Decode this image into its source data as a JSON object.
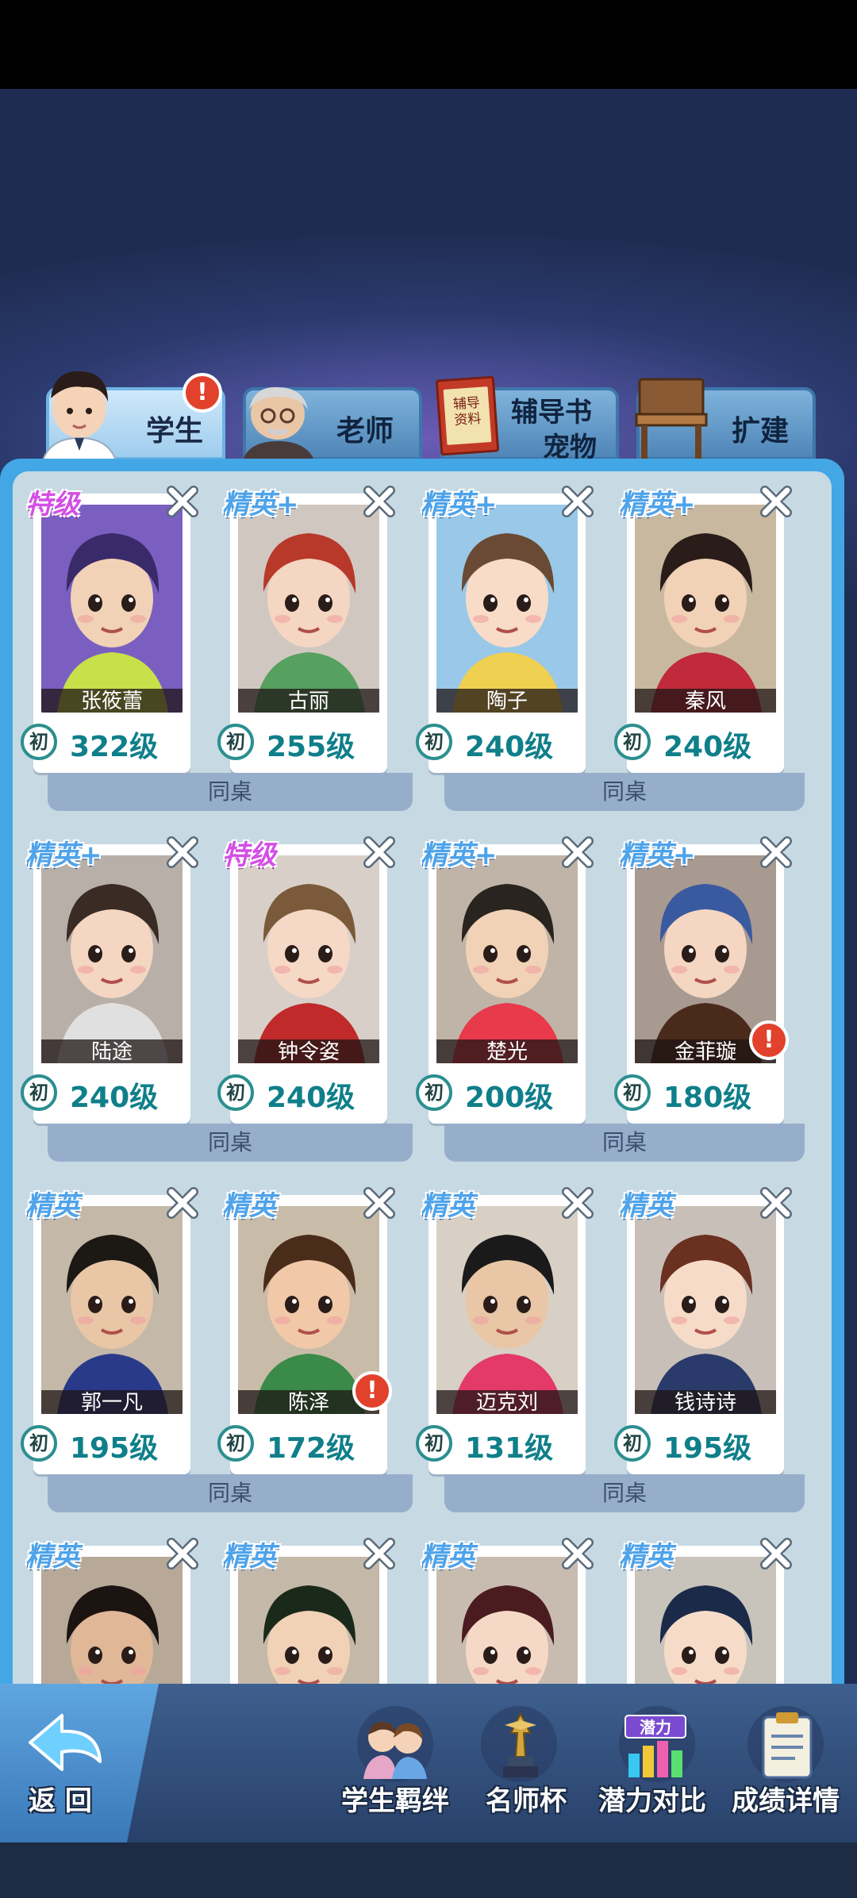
{
  "tabs": [
    {
      "label": "学生",
      "active": true
    },
    {
      "label": "老师",
      "active": false
    },
    {
      "label": "辅导书\n宠物",
      "line1": "辅导书",
      "line2": "宠物",
      "active": false
    },
    {
      "label": "扩建",
      "active": false
    }
  ],
  "tab_book_text": "辅导\n资料",
  "tab_book_line1": "辅导",
  "tab_book_line2": "资料",
  "students": [
    {
      "name": "张筱蕾",
      "level": "322级",
      "rank": "特级",
      "grade": "初",
      "badge": false
    },
    {
      "name": "古丽",
      "level": "255级",
      "rank": "精英+",
      "grade": "初",
      "badge": false
    },
    {
      "name": "陶子",
      "level": "240级",
      "rank": "精英+",
      "grade": "初",
      "badge": false
    },
    {
      "name": "秦风",
      "level": "240级",
      "rank": "精英+",
      "grade": "初",
      "badge": false
    },
    {
      "name": "陆途",
      "level": "240级",
      "rank": "精英+",
      "grade": "初",
      "badge": false
    },
    {
      "name": "钟令姿",
      "level": "240级",
      "rank": "特级",
      "grade": "初",
      "badge": false
    },
    {
      "name": "楚光",
      "level": "200级",
      "rank": "精英+",
      "grade": "初",
      "badge": false
    },
    {
      "name": "金菲璇",
      "level": "180级",
      "rank": "精英+",
      "grade": "初",
      "badge": true
    },
    {
      "name": "郭一凡",
      "level": "195级",
      "rank": "精英",
      "grade": "初",
      "badge": false
    },
    {
      "name": "陈泽",
      "level": "172级",
      "rank": "精英",
      "grade": "初",
      "badge": true
    },
    {
      "name": "迈克刘",
      "level": "131级",
      "rank": "精英",
      "grade": "初",
      "badge": false
    },
    {
      "name": "钱诗诗",
      "level": "195级",
      "rank": "精英",
      "grade": "初",
      "badge": false
    },
    {
      "name": "",
      "level": "",
      "rank": "精英",
      "grade": "",
      "badge": false
    },
    {
      "name": "",
      "level": "",
      "rank": "精英",
      "grade": "",
      "badge": false
    },
    {
      "name": "",
      "level": "",
      "rank": "精英",
      "grade": "",
      "badge": false
    },
    {
      "name": "",
      "level": "",
      "rank": "精英",
      "grade": "",
      "badge": false
    }
  ],
  "desk_label": "同桌",
  "bottom": {
    "back": "返 回",
    "items": [
      {
        "label": "学生羁绊",
        "icon": "students-bond-icon"
      },
      {
        "label": "名师杯",
        "icon": "trophy-icon"
      },
      {
        "label": "潜力对比",
        "icon": "potential-chart-icon"
      },
      {
        "label": "成绩详情",
        "icon": "report-clipboard-icon"
      }
    ],
    "potential_icon_text": "潜力"
  },
  "colors": {
    "accent_blue": "#43a7e6",
    "level_text": "#0f7f8a",
    "rank_special": "#d44ee6",
    "rank_elite": "#4ea3ea",
    "badge_red": "#e2412b"
  }
}
